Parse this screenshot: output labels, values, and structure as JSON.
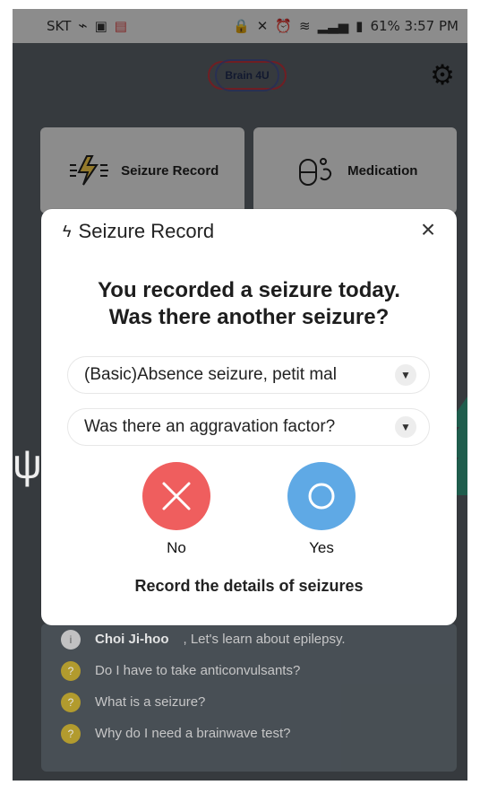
{
  "statusbar": {
    "carrier": "SKT",
    "status_text": "61% 3:57 PM"
  },
  "header": {
    "logo_text": "Brain 4U"
  },
  "cards": {
    "seizure_record": "Seizure Record",
    "medication": "Medication"
  },
  "modal": {
    "title": "Seizure Record",
    "question_line1": "You recorded a seizure today.",
    "question_line2": "Was there another seizure?",
    "select1_value": "(Basic)Absence seizure, petit mal",
    "select2_value": "Was there an aggravation factor?",
    "no_label": "No",
    "yes_label": "Yes",
    "details_link": "Record the details of seizures"
  },
  "bottom": {
    "name": "Choi Ji-hoo",
    "greeting": ", Let's learn about epilepsy.",
    "faq1": "Do I have to take anticonvulsants?",
    "faq2": "What is a seizure?",
    "faq3": "Why do I need a brainwave test?"
  },
  "colors": {
    "modal_bg": "#ffffff",
    "no": "#ef5e5e",
    "yes": "#5fa9e5",
    "overlay": "#5d646b"
  }
}
